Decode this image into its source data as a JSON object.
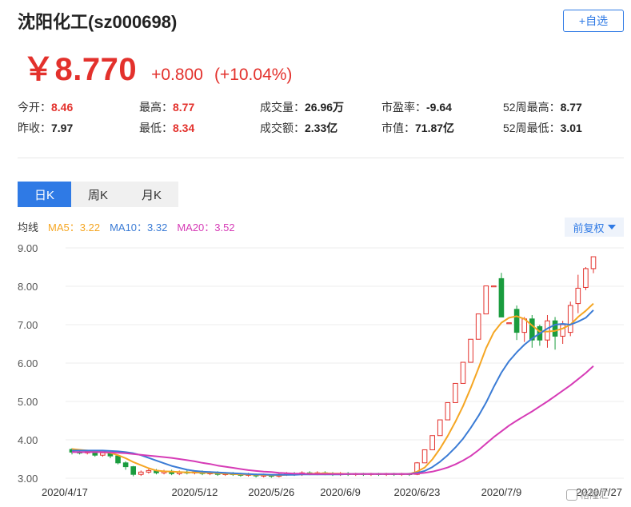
{
  "header": {
    "title": "沈阳化工(sz000698)",
    "add_watch": "+自选"
  },
  "quote": {
    "price": "￥8.770",
    "change": "+0.800",
    "change_pct": "(+10.04%)"
  },
  "stats": {
    "row1": [
      {
        "label": "今开：",
        "value": "8.46",
        "color": "red"
      },
      {
        "label": "最高：",
        "value": "8.77",
        "color": "red"
      },
      {
        "label": "成交量：",
        "value": "26.96万",
        "color": "dark"
      },
      {
        "label": "市盈率：",
        "value": "-9.64",
        "color": "dark"
      },
      {
        "label": "52周最高：",
        "value": "8.77",
        "color": "dark"
      }
    ],
    "row2": [
      {
        "label": "昨收：",
        "value": "7.97",
        "color": "dark"
      },
      {
        "label": "最低：",
        "value": "8.34",
        "color": "red"
      },
      {
        "label": "成交额：",
        "value": "2.33亿",
        "color": "dark"
      },
      {
        "label": "市值：",
        "value": "71.87亿",
        "color": "dark"
      },
      {
        "label": "52周最低：",
        "value": "3.01",
        "color": "dark"
      }
    ]
  },
  "tabs": [
    {
      "label": "日K",
      "active": true
    },
    {
      "label": "周K",
      "active": false
    },
    {
      "label": "月K",
      "active": false
    }
  ],
  "legend": {
    "label": "均线",
    "ma5": "MA5：3.22",
    "ma10": "MA10：3.32",
    "ma20": "MA20：3.52"
  },
  "adjust_button": "前复权",
  "watermark": "格隆汇",
  "colors": {
    "up": "#e3312c",
    "down": "#1a9c3e",
    "ma5": "#f5a623",
    "ma10": "#3a7bd5",
    "ma20": "#d63bb6",
    "accent": "#2f7ae5"
  },
  "chart_data": {
    "type": "candlestick",
    "ylim": [
      3.0,
      9.0
    ],
    "y_ticks": [
      "3.00",
      "4.00",
      "5.00",
      "6.00",
      "7.00",
      "8.00",
      "9.00"
    ],
    "x_ticks": [
      {
        "index": 0,
        "label": "2020/4/17"
      },
      {
        "index": 16,
        "label": "2020/5/12"
      },
      {
        "index": 26,
        "label": "2020/5/26"
      },
      {
        "index": 35,
        "label": "2020/6/9"
      },
      {
        "index": 45,
        "label": "2020/6/23"
      },
      {
        "index": 56,
        "label": "2020/7/9"
      },
      {
        "index": 69,
        "label": "2020/7/27"
      }
    ],
    "candles": [
      [
        3.75,
        3.68,
        3.78,
        3.62
      ],
      [
        3.68,
        3.66,
        3.72,
        3.62
      ],
      [
        3.66,
        3.7,
        3.74,
        3.62
      ],
      [
        3.7,
        3.6,
        3.72,
        3.56
      ],
      [
        3.6,
        3.66,
        3.7,
        3.56
      ],
      [
        3.66,
        3.58,
        3.7,
        3.52
      ],
      [
        3.58,
        3.4,
        3.6,
        3.36
      ],
      [
        3.4,
        3.3,
        3.44,
        3.22
      ],
      [
        3.3,
        3.1,
        3.32,
        3.05
      ],
      [
        3.1,
        3.16,
        3.2,
        3.06
      ],
      [
        3.16,
        3.2,
        3.24,
        3.12
      ],
      [
        3.2,
        3.14,
        3.24,
        3.1
      ],
      [
        3.14,
        3.18,
        3.22,
        3.1
      ],
      [
        3.18,
        3.12,
        3.22,
        3.08
      ],
      [
        3.12,
        3.16,
        3.2,
        3.08
      ],
      [
        3.16,
        3.14,
        3.2,
        3.1
      ],
      [
        3.14,
        3.16,
        3.2,
        3.1
      ],
      [
        3.16,
        3.12,
        3.2,
        3.08
      ],
      [
        3.12,
        3.14,
        3.18,
        3.08
      ],
      [
        3.14,
        3.1,
        3.18,
        3.06
      ],
      [
        3.1,
        3.12,
        3.16,
        3.06
      ],
      [
        3.12,
        3.1,
        3.16,
        3.06
      ],
      [
        3.1,
        3.08,
        3.14,
        3.04
      ],
      [
        3.08,
        3.1,
        3.14,
        3.04
      ],
      [
        3.1,
        3.06,
        3.12,
        3.02
      ],
      [
        3.06,
        3.08,
        3.12,
        3.02
      ],
      [
        3.08,
        3.05,
        3.1,
        3.01
      ],
      [
        3.05,
        3.1,
        3.14,
        3.02
      ],
      [
        3.1,
        3.12,
        3.16,
        3.06
      ],
      [
        3.12,
        3.1,
        3.16,
        3.06
      ],
      [
        3.1,
        3.14,
        3.18,
        3.06
      ],
      [
        3.14,
        3.12,
        3.18,
        3.08
      ],
      [
        3.12,
        3.14,
        3.18,
        3.08
      ],
      [
        3.14,
        3.12,
        3.18,
        3.08
      ],
      [
        3.12,
        3.1,
        3.16,
        3.06
      ],
      [
        3.1,
        3.12,
        3.16,
        3.06
      ],
      [
        3.12,
        3.1,
        3.16,
        3.06
      ],
      [
        3.1,
        3.12,
        3.14,
        3.06
      ],
      [
        3.12,
        3.1,
        3.14,
        3.06
      ],
      [
        3.1,
        3.12,
        3.14,
        3.06
      ],
      [
        3.12,
        3.1,
        3.14,
        3.06
      ],
      [
        3.1,
        3.12,
        3.14,
        3.06
      ],
      [
        3.12,
        3.1,
        3.14,
        3.06
      ],
      [
        3.1,
        3.12,
        3.14,
        3.06
      ],
      [
        3.12,
        3.1,
        3.14,
        3.06
      ],
      [
        3.1,
        3.4,
        3.42,
        3.08
      ],
      [
        3.4,
        3.74,
        3.74,
        3.4
      ],
      [
        3.74,
        4.11,
        4.11,
        3.74
      ],
      [
        4.11,
        4.52,
        4.52,
        4.11
      ],
      [
        4.52,
        4.97,
        4.97,
        4.52
      ],
      [
        4.97,
        5.47,
        5.47,
        4.97
      ],
      [
        5.47,
        6.02,
        6.02,
        5.47
      ],
      [
        6.02,
        6.62,
        6.62,
        6.02
      ],
      [
        6.62,
        7.28,
        7.28,
        6.62
      ],
      [
        7.28,
        8.01,
        8.01,
        7.28
      ],
      [
        8.01,
        8.01,
        8.01,
        8.01
      ],
      [
        8.2,
        7.2,
        8.35,
        7.2
      ],
      [
        7.05,
        7.05,
        7.05,
        7.05
      ],
      [
        7.4,
        6.8,
        7.5,
        6.6
      ],
      [
        6.8,
        7.15,
        7.2,
        6.55
      ],
      [
        7.15,
        6.6,
        7.25,
        6.4
      ],
      [
        6.95,
        6.6,
        7.0,
        6.45
      ],
      [
        6.6,
        7.1,
        7.25,
        6.4
      ],
      [
        7.1,
        6.7,
        7.2,
        6.35
      ],
      [
        6.7,
        7.0,
        7.1,
        6.5
      ],
      [
        6.8,
        7.5,
        7.6,
        6.7
      ],
      [
        7.55,
        7.95,
        8.3,
        7.3
      ],
      [
        7.97,
        8.46,
        8.5,
        7.9
      ],
      [
        8.46,
        8.77,
        8.77,
        8.34
      ]
    ],
    "series": [
      {
        "name": "MA5",
        "values": [
          3.76,
          3.74,
          3.72,
          3.7,
          3.68,
          3.66,
          3.6,
          3.52,
          3.42,
          3.34,
          3.26,
          3.2,
          3.18,
          3.17,
          3.16,
          3.15,
          3.15,
          3.14,
          3.14,
          3.13,
          3.12,
          3.11,
          3.1,
          3.1,
          3.09,
          3.09,
          3.08,
          3.08,
          3.09,
          3.1,
          3.11,
          3.12,
          3.12,
          3.13,
          3.12,
          3.12,
          3.11,
          3.11,
          3.11,
          3.11,
          3.11,
          3.11,
          3.11,
          3.11,
          3.11,
          3.17,
          3.28,
          3.49,
          3.77,
          4.1,
          4.47,
          4.88,
          5.35,
          5.86,
          6.39,
          6.8,
          7.05,
          7.18,
          7.22,
          7.15,
          6.98,
          6.82,
          6.82,
          6.84,
          6.9,
          7.0,
          7.2,
          7.36,
          7.55
        ]
      },
      {
        "name": "MA10",
        "values": [
          3.72,
          3.72,
          3.72,
          3.72,
          3.72,
          3.71,
          3.7,
          3.68,
          3.65,
          3.6,
          3.53,
          3.46,
          3.39,
          3.32,
          3.27,
          3.22,
          3.19,
          3.17,
          3.16,
          3.15,
          3.14,
          3.13,
          3.12,
          3.11,
          3.1,
          3.1,
          3.09,
          3.09,
          3.09,
          3.09,
          3.1,
          3.1,
          3.1,
          3.1,
          3.1,
          3.1,
          3.11,
          3.11,
          3.11,
          3.11,
          3.11,
          3.11,
          3.11,
          3.11,
          3.11,
          3.14,
          3.19,
          3.29,
          3.43,
          3.6,
          3.8,
          4.03,
          4.31,
          4.62,
          4.97,
          5.38,
          5.75,
          6.05,
          6.28,
          6.48,
          6.64,
          6.77,
          6.9,
          7.0,
          7.02,
          7.0,
          7.08,
          7.18,
          7.38
        ]
      },
      {
        "name": "MA20",
        "values": [
          3.68,
          3.68,
          3.68,
          3.68,
          3.68,
          3.67,
          3.66,
          3.65,
          3.63,
          3.61,
          3.59,
          3.57,
          3.55,
          3.53,
          3.5,
          3.47,
          3.44,
          3.4,
          3.37,
          3.33,
          3.3,
          3.27,
          3.24,
          3.21,
          3.19,
          3.17,
          3.16,
          3.14,
          3.13,
          3.12,
          3.12,
          3.11,
          3.11,
          3.11,
          3.11,
          3.11,
          3.11,
          3.11,
          3.11,
          3.11,
          3.11,
          3.11,
          3.11,
          3.11,
          3.11,
          3.12,
          3.14,
          3.17,
          3.22,
          3.28,
          3.36,
          3.46,
          3.58,
          3.73,
          3.9,
          4.07,
          4.22,
          4.37,
          4.5,
          4.62,
          4.74,
          4.87,
          5.0,
          5.14,
          5.28,
          5.42,
          5.58,
          5.74,
          5.92
        ]
      }
    ]
  }
}
